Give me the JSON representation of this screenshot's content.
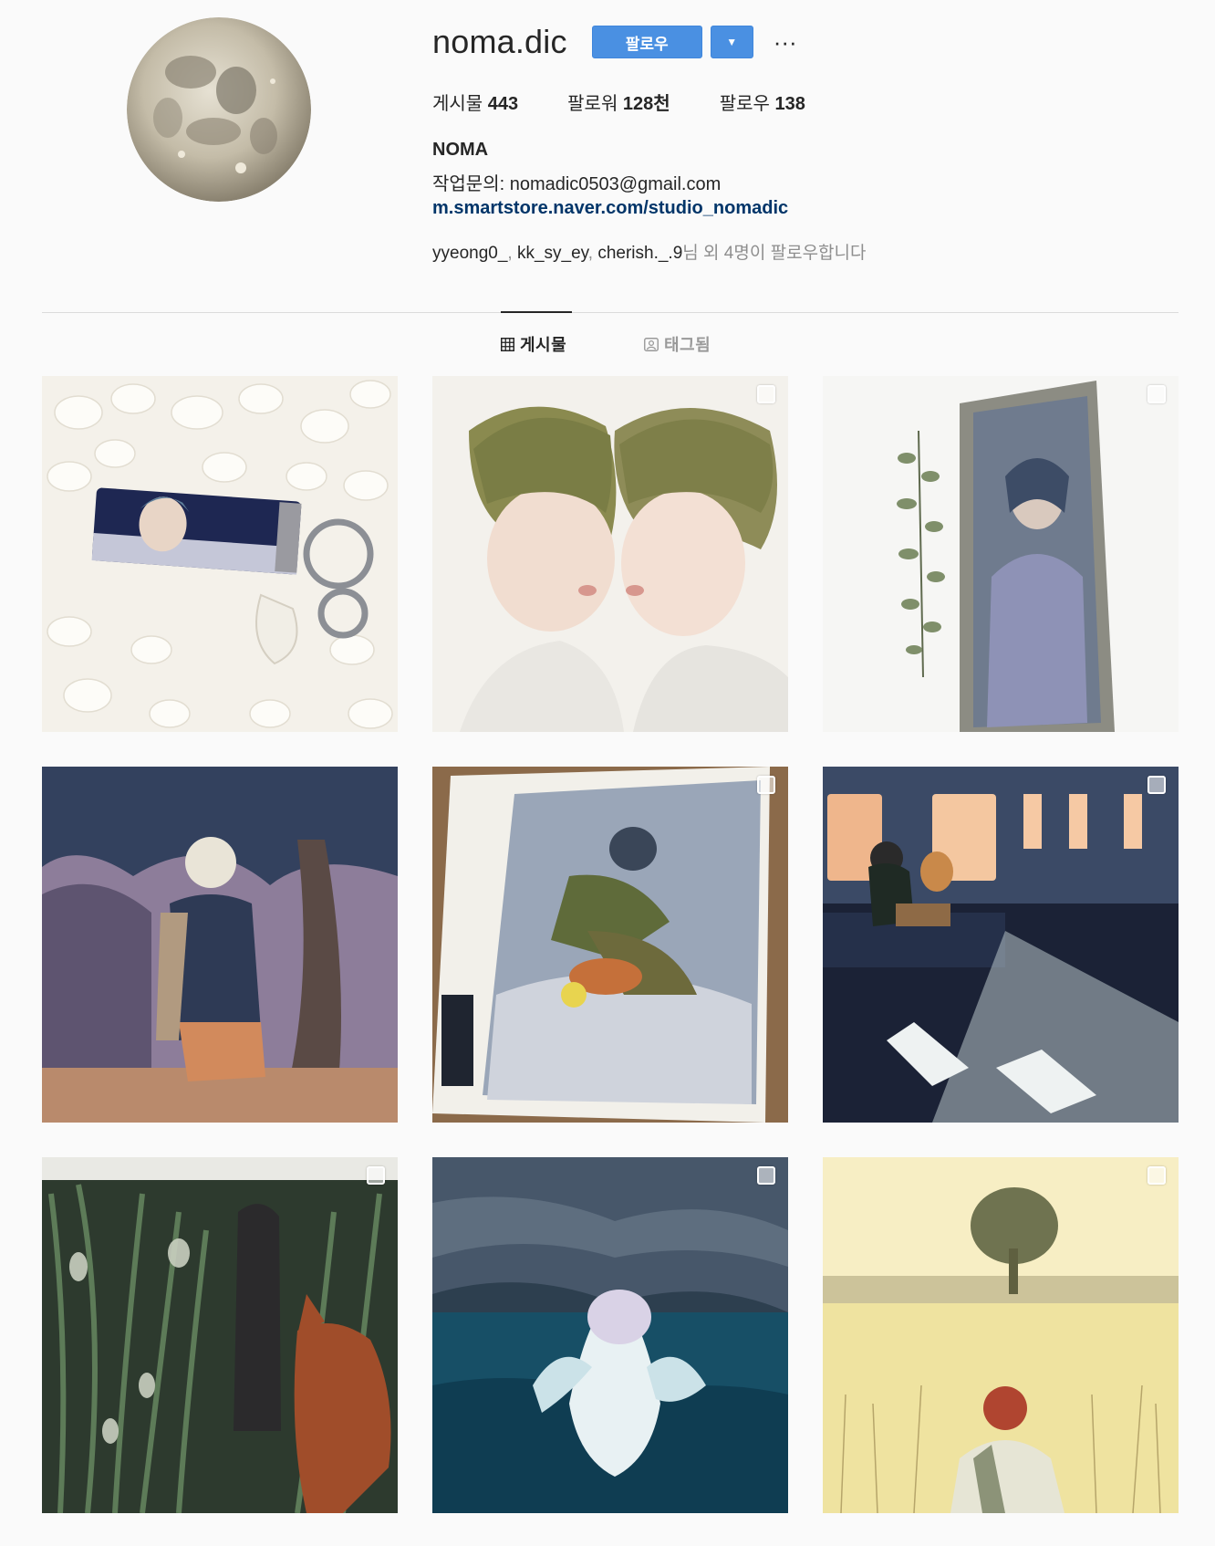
{
  "profile": {
    "username": "noma.dic",
    "follow_label": "팔로우",
    "dropdown_glyph": "▼",
    "more_glyph": "···",
    "stats": {
      "posts_label": "게시물",
      "posts_value": "443",
      "followers_label": "팔로워",
      "followers_value": "128천",
      "following_label": "팔로우",
      "following_value": "138"
    },
    "full_name": "NOMA",
    "bio": "작업문의: nomadic0503@gmail.com",
    "link": "m.smartstore.naver.com/studio_nomadic",
    "followed_by": {
      "users": [
        "yyeong0_",
        "kk_sy_ey",
        "cherish._.9"
      ],
      "separator": ", ",
      "suffix": "님 외 4명이 팔로우합니다"
    }
  },
  "tabs": {
    "posts": "게시물",
    "tagged": "태그됨"
  },
  "posts": [
    {
      "name": "keychain-photo",
      "multi": false
    },
    {
      "name": "two-boys-illustration",
      "multi": true
    },
    {
      "name": "framed-painting-eucalyptus",
      "multi": true
    },
    {
      "name": "boy-under-tree-illustration",
      "multi": false
    },
    {
      "name": "big-issue-magazine",
      "multi": true
    },
    {
      "name": "subway-dog-illustration",
      "multi": true
    },
    {
      "name": "fox-in-grass-illustration",
      "multi": true
    },
    {
      "name": "ocean-wave-illustration",
      "multi": true
    },
    {
      "name": "wheat-field-girl-illustration",
      "multi": true
    }
  ],
  "colors": {
    "follow_button": "#4a90e2",
    "link": "#003569",
    "muted_text": "#8e8e8e"
  }
}
